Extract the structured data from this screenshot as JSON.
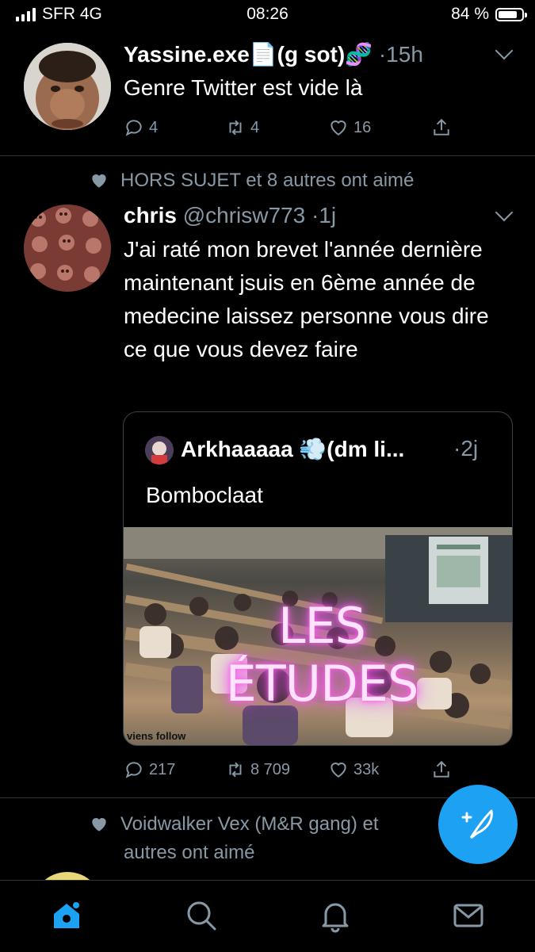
{
  "status": {
    "carrier": "SFR 4G",
    "time": "08:26",
    "battery": "84 %",
    "battery_level": 0.84
  },
  "colors": {
    "accent": "#1da1f2",
    "muted": "#8899a6",
    "divider": "#2f3336",
    "glow": "#ff5cf0"
  },
  "feed": {
    "tweet1": {
      "display_name": "Yassine.exe📄(g sot)🧬",
      "time": "·15h",
      "text": "Genre Twitter est vide là",
      "replies": "4",
      "retweets": "4",
      "likes": "16"
    },
    "tweet2": {
      "social_context": "HORS SUJET et 8 autres ont aimé",
      "display_name": "chris",
      "handle": "@chrisw773",
      "time": "·1j",
      "text": "J'ai raté mon brevet l'année dernière maintenant jsuis en 6ème année de medecine laissez personne vous dire ce que vous devez faire",
      "replies": "217",
      "retweets": "8 709",
      "likes": "33k",
      "quote": {
        "display_name": "Arkhaaaaa 💨(dm li...",
        "time": "·2j",
        "text": "Bomboclaat",
        "image_caption": "LES ÉTUDES",
        "image_watermark": "viens follow"
      }
    },
    "tweet3": {
      "social_context_line1": "Voidwalker Vex (M&R gang) et",
      "social_context_line2": "autres ont aimé"
    }
  },
  "tabbar": {
    "tabs": [
      "home",
      "search",
      "notifications",
      "messages"
    ],
    "active": "home"
  }
}
